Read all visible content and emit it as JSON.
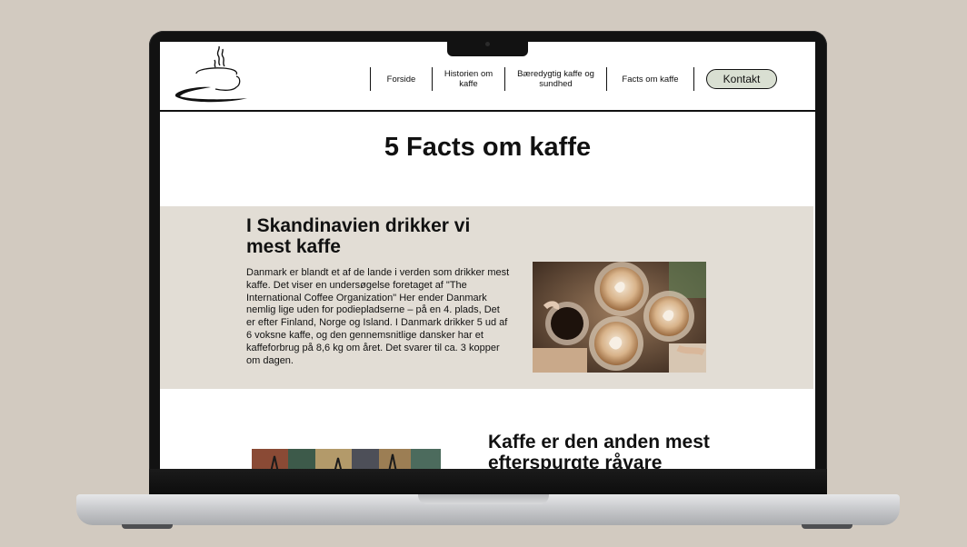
{
  "nav": {
    "items": [
      {
        "label": "Forside"
      },
      {
        "label": "Historien om kaffe"
      },
      {
        "label": "Bæredygtig kaffe og sundhed"
      },
      {
        "label": "Facts om kaffe"
      }
    ],
    "contact_label": "Kontakt"
  },
  "page": {
    "title": "5 Facts om kaffe"
  },
  "fact1": {
    "heading": "I Skandinavien drikker vi mest kaffe",
    "body": "Danmark er blandt et af de lande i verden som drikker mest kaffe. Det viser en undersøgelse foretaget af \"The International Coffee Organization\" Her ender Danmark nemlig lige uden for podiepladserne – på en 4. plads, Det er efter Finland, Norge og Island. I Danmark drikker 5 ud af 6 voksne kaffe, og den gennemsnitlige dansker har et kaffeforbrug på 8,6 kg om året. Det svarer til ca. 3 kopper om dagen."
  },
  "fact2": {
    "heading": "Kaffe er den anden mest efterspurgte råvare"
  },
  "colors": {
    "background": "#d2cac0",
    "band": "#e2ddd5",
    "contact_button": "#d9dfd2",
    "text": "#111111"
  },
  "icons": {
    "logo": "coffee-cup-logo-icon"
  }
}
